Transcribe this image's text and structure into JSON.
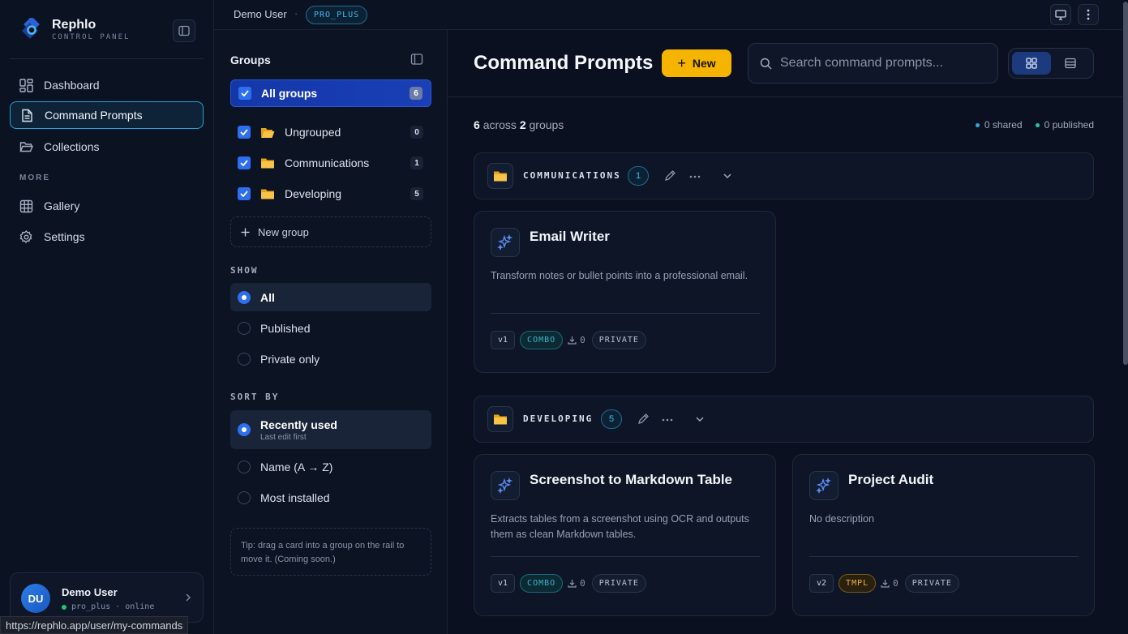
{
  "brand": {
    "name": "Rephlo",
    "subtitle": "CONTROL PANEL"
  },
  "nav": {
    "items": [
      {
        "label": "Dashboard",
        "icon": "dashboard-icon"
      },
      {
        "label": "Command Prompts",
        "icon": "document-icon",
        "active": true
      },
      {
        "label": "Collections",
        "icon": "folder-open-icon"
      }
    ],
    "more_label": "MORE",
    "more_items": [
      {
        "label": "Gallery",
        "icon": "grid-icon"
      },
      {
        "label": "Settings",
        "icon": "gear-icon"
      }
    ]
  },
  "user": {
    "initials": "DU",
    "name": "Demo User",
    "status": "pro_plus · online"
  },
  "status_url": "https://rephlo.app/user/my-commands",
  "topbar": {
    "user": "Demo User",
    "separator": "·",
    "plan": "PRO_PLUS"
  },
  "groups_panel": {
    "title": "Groups",
    "all": {
      "label": "All groups",
      "count": "6"
    },
    "items": [
      {
        "label": "Ungrouped",
        "count": "0"
      },
      {
        "label": "Communications",
        "count": "1"
      },
      {
        "label": "Developing",
        "count": "5"
      }
    ],
    "new_group": "New group",
    "show_label": "SHOW",
    "show_options": [
      "All",
      "Published",
      "Private only"
    ],
    "sort_label": "SORT BY",
    "sort_options": [
      {
        "label": "Recently used",
        "sub": "Last edit first"
      },
      {
        "label": "Name (A → Z)"
      },
      {
        "label": "Most installed"
      }
    ],
    "tip": "Tip: drag a card into a group on the rail to move it. (Coming soon.)"
  },
  "main": {
    "title": "Command Prompts",
    "new_button": "New",
    "search_placeholder": "Search command prompts...",
    "summary": {
      "count": "6",
      "across": "across",
      "groups": "2",
      "groups_label": "groups"
    },
    "legend": {
      "shared": "0 shared",
      "published": "0 published"
    },
    "group_sections": [
      {
        "name": "COMMUNICATIONS",
        "count": "1",
        "cards": [
          {
            "title": "Email Writer",
            "desc": "Transform notes or bullet points into a professional email.",
            "version": "v1",
            "type": "COMBO",
            "installs": "0",
            "visibility": "PRIVATE"
          }
        ]
      },
      {
        "name": "DEVELOPING",
        "count": "5",
        "cards": [
          {
            "title": "Screenshot to Markdown Table",
            "desc": "Extracts tables from a screenshot using OCR and outputs them as clean Markdown tables.",
            "version": "v1",
            "type": "COMBO",
            "installs": "0",
            "visibility": "PRIVATE"
          },
          {
            "title": "Project Audit",
            "desc": "No description",
            "version": "v2",
            "type": "TMPL",
            "installs": "0",
            "visibility": "PRIVATE"
          }
        ]
      }
    ]
  },
  "colors": {
    "accent": "#f5b400",
    "primary": "#2d6ff0",
    "cyan": "#2a9fd8",
    "background": "#0a1020"
  }
}
